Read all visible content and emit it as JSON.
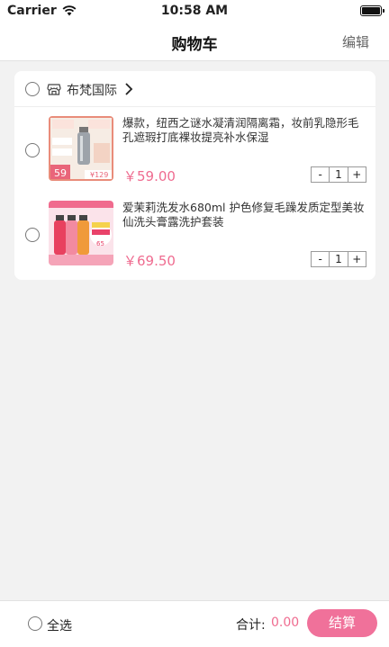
{
  "status_bar": {
    "carrier": "Carrier",
    "time": "10:58 AM"
  },
  "nav": {
    "title": "购物车",
    "edit": "编辑"
  },
  "shop": {
    "name": "布梵国际"
  },
  "items": [
    {
      "title": "爆款，纽西之谜水凝清润隔离霜，妆前乳隐形毛孔遮瑕打底裸妆提亮补水保湿",
      "price": "￥59.00",
      "quantity": "1",
      "minus": "-",
      "plus": "+"
    },
    {
      "title": "爱茉莉洗发水680ml 护色修复毛躁发质定型美妆仙洗头膏露洗护套装",
      "price": "￥69.50",
      "quantity": "1",
      "minus": "-",
      "plus": "+"
    }
  ],
  "footer": {
    "select_all": "全选",
    "total_label": "合计:",
    "total_value": "0.00",
    "checkout": "结算"
  },
  "colors": {
    "accent": "#f0719a",
    "price": "#ef6c90"
  }
}
